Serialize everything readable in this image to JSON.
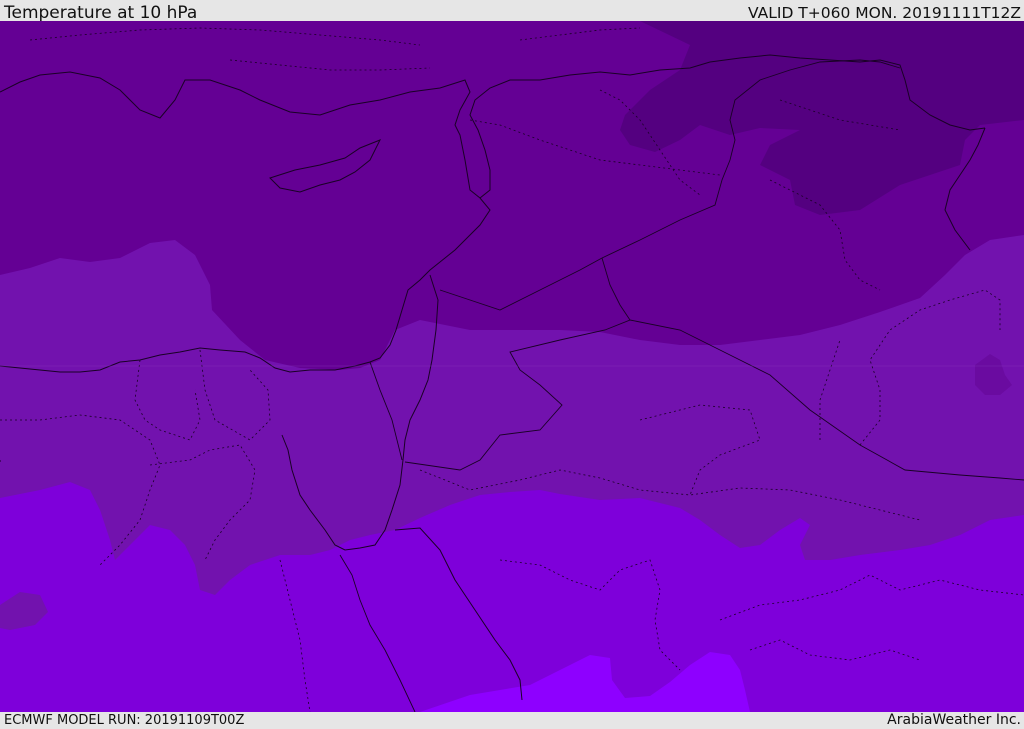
{
  "header": {
    "title": "Temperature at 10 hPa",
    "valid": "VALID T+060 MON. 20191111T12Z"
  },
  "footer": {
    "model_run": "ECMWF MODEL RUN: 20191109T00Z",
    "brand": "ArabiaWeather Inc."
  },
  "map": {
    "colors": {
      "darkest": "#540080",
      "dark": "#640094",
      "mid": "#7212ae",
      "light": "#7e00da",
      "lightest": "#8e00ff",
      "borders": "#1a0026"
    }
  }
}
